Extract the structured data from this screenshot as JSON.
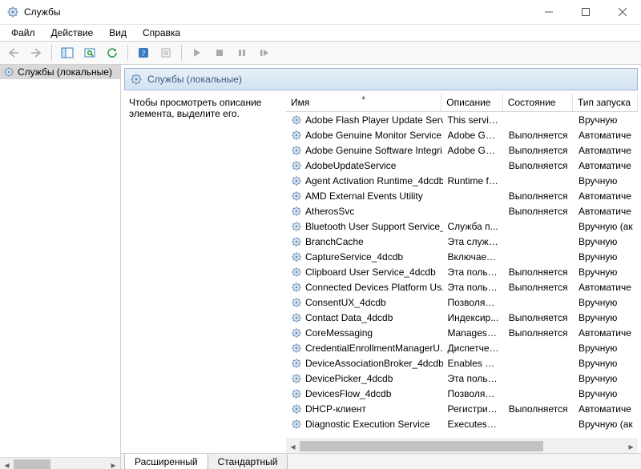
{
  "window": {
    "title": "Службы"
  },
  "menu": {
    "file": "Файл",
    "action": "Действие",
    "view": "Вид",
    "help": "Справка"
  },
  "tree": {
    "root": "Службы (локальные)"
  },
  "panel": {
    "title": "Службы (локальные)"
  },
  "description": {
    "line1": "Чтобы просмотреть описание",
    "line2": "элемента, выделите его."
  },
  "columns": {
    "name": "Имя",
    "desc": "Описание",
    "state": "Состояние",
    "start": "Тип запуска"
  },
  "tabs": {
    "extended": "Расширенный",
    "standard": "Стандартный"
  },
  "services": [
    {
      "name": "Adobe Flash Player Update Servi...",
      "desc": "This servic...",
      "state": "",
      "start": "Вручную"
    },
    {
      "name": "Adobe Genuine Monitor Service",
      "desc": "Adobe Gen...",
      "state": "Выполняется",
      "start": "Автоматиче"
    },
    {
      "name": "Adobe Genuine Software Integri...",
      "desc": "Adobe Gen...",
      "state": "Выполняется",
      "start": "Автоматиче"
    },
    {
      "name": "AdobeUpdateService",
      "desc": "",
      "state": "Выполняется",
      "start": "Автоматиче"
    },
    {
      "name": "Agent Activation Runtime_4dcdb",
      "desc": "Runtime fo...",
      "state": "",
      "start": "Вручную"
    },
    {
      "name": "AMD External Events Utility",
      "desc": "",
      "state": "Выполняется",
      "start": "Автоматиче"
    },
    {
      "name": "AtherosSvc",
      "desc": "",
      "state": "Выполняется",
      "start": "Автоматиче"
    },
    {
      "name": "Bluetooth User Support Service_...",
      "desc": "Служба п...",
      "state": "",
      "start": "Вручную (ак"
    },
    {
      "name": "BranchCache",
      "desc": "Эта служб...",
      "state": "",
      "start": "Вручную"
    },
    {
      "name": "CaptureService_4dcdb",
      "desc": "Включает ...",
      "state": "",
      "start": "Вручную"
    },
    {
      "name": "Clipboard User Service_4dcdb",
      "desc": "Эта польз...",
      "state": "Выполняется",
      "start": "Вручную"
    },
    {
      "name": "Connected Devices Platform Us...",
      "desc": "Эта польз...",
      "state": "Выполняется",
      "start": "Автоматиче"
    },
    {
      "name": "ConsentUX_4dcdb",
      "desc": "Позволяет...",
      "state": "",
      "start": "Вручную"
    },
    {
      "name": "Contact Data_4dcdb",
      "desc": "Индексир...",
      "state": "Выполняется",
      "start": "Вручную"
    },
    {
      "name": "CoreMessaging",
      "desc": "Manages c...",
      "state": "Выполняется",
      "start": "Автоматиче"
    },
    {
      "name": "CredentialEnrollmentManagerU...",
      "desc": "Диспетчер...",
      "state": "",
      "start": "Вручную"
    },
    {
      "name": "DeviceAssociationBroker_4dcdb",
      "desc": "Enables ap...",
      "state": "",
      "start": "Вручную"
    },
    {
      "name": "DevicePicker_4dcdb",
      "desc": "Эта польз...",
      "state": "",
      "start": "Вручную"
    },
    {
      "name": "DevicesFlow_4dcdb",
      "desc": "Позволяет...",
      "state": "",
      "start": "Вручную"
    },
    {
      "name": "DHCP-клиент",
      "desc": "Регистрир...",
      "state": "Выполняется",
      "start": "Автоматиче"
    },
    {
      "name": "Diagnostic Execution Service",
      "desc": "Executes di...",
      "state": "",
      "start": "Вручную (ак"
    }
  ]
}
